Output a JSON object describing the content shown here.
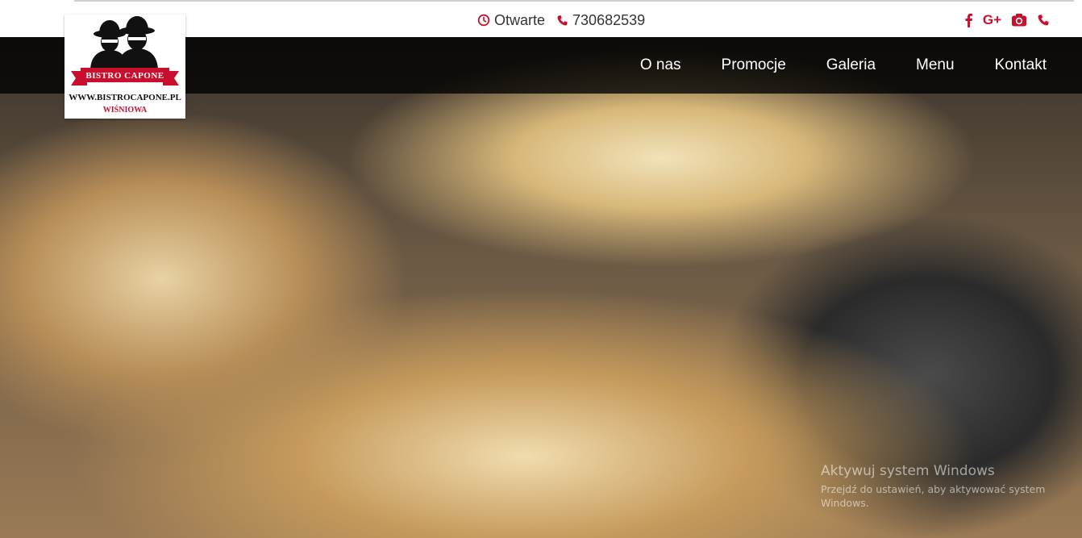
{
  "topbar": {
    "status_text": "Otwarte",
    "phone": "730682539",
    "icons": [
      "clock-icon",
      "phone-icon"
    ],
    "social": [
      "facebook-icon",
      "google-plus-icon",
      "camera-icon",
      "phone-icon"
    ],
    "gplus_label": "G+"
  },
  "logo": {
    "name": "BISTRO CAPONE",
    "url": "WWW.BISTROCAPONE.PL",
    "city": "WIŚNIOWA"
  },
  "nav": {
    "items": [
      "O nas",
      "Promocje",
      "Galeria",
      "Menu",
      "Kontakt"
    ]
  },
  "watermark": {
    "heading": "Aktywuj system Windows",
    "subtext": "Przejdź do ustawień, aby aktywować system Windows."
  },
  "colors": {
    "accent": "#c8102e",
    "navbar": "#000000",
    "text": "#333333"
  }
}
